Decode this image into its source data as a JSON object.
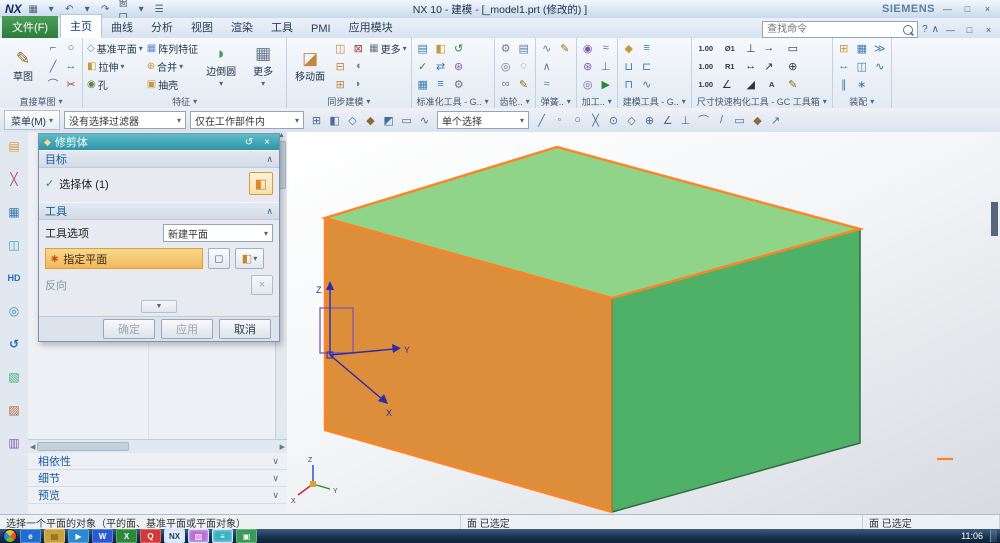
{
  "window": {
    "logo": "NX",
    "title": "NX 10 - 建模 - [_model1.prt (修改的) ]",
    "brand": "SIEMENS",
    "menu_window": "窗口"
  },
  "icons": {
    "save": "▦",
    "undo": "↶",
    "redo": "↷",
    "menu_list": "☰",
    "minimize": "—",
    "restore": "□",
    "close": "×",
    "help": "?",
    "ribbon_collapse": "∧",
    "chevron_up": "∧",
    "chevron_down": "∨",
    "dropdown": "▾",
    "check": "✓",
    "reset": "↺",
    "star": "∗",
    "expand_more": "▼",
    "cube": "◧",
    "plane": "◻",
    "plane_dialog": "◆",
    "reverse": "×",
    "scroll_up": "▲",
    "scroll_down": "▼",
    "scroll_left": "◀",
    "scroll_right": "▶"
  },
  "tabs": {
    "file_tab": "文件(F)",
    "items": [
      "主页",
      "曲线",
      "分析",
      "视图",
      "渲染",
      "工具",
      "PMI",
      "应用模块"
    ],
    "active_index": 0,
    "search_placeholder": "查找命令"
  },
  "ribbon": {
    "groups": [
      {
        "label": "直接草图",
        "name": "direct-sketch",
        "items": [
          {
            "n": "sketch-button",
            "t": "草图",
            "g": "✎",
            "c": "#8a6d1f",
            "big": true
          },
          {
            "n": "profile-icon",
            "g": "⌐",
            "c": "#3a6ea5"
          },
          {
            "n": "line-icon",
            "g": "╱",
            "c": "#3a6ea5"
          },
          {
            "n": "arc-icon",
            "g": "⌒",
            "c": "#3a6ea5"
          },
          {
            "n": "circle-icon",
            "g": "○",
            "c": "#3a6ea5"
          },
          {
            "n": "rapid-dimension-icon",
            "g": "↔",
            "c": "#3a6ea5"
          },
          {
            "n": "quick-trim-icon",
            "g": "✂",
            "c": "#a04040"
          }
        ]
      },
      {
        "label": "特征",
        "name": "feature",
        "items": [
          {
            "n": "datum-plane-button",
            "t": "基准平面",
            "g": "◇",
            "c": "#5b8fd4",
            "dd": true
          },
          {
            "n": "extrude-button",
            "t": "拉伸",
            "g": "◧",
            "c": "#c49a3a",
            "dd": true
          },
          {
            "n": "hole-button",
            "t": "孔",
            "g": "◉",
            "c": "#5a8a3a"
          },
          {
            "n": "pattern-feature-button",
            "t": "阵列特征",
            "g": "▦",
            "c": "#5b8fd4"
          },
          {
            "n": "unite-button",
            "t": "合并",
            "g": "⊕",
            "c": "#c49a3a",
            "dd": true
          },
          {
            "n": "shell-button",
            "t": "抽壳",
            "g": "▣",
            "c": "#c49a3a"
          },
          {
            "n": "edge-blend-button",
            "t": "边倒圆",
            "g": "◗",
            "c": "#4aa05a",
            "big": true,
            "dd": true
          },
          {
            "n": "more-feature-button",
            "t": "更多",
            "g": "▦",
            "c": "#667788",
            "big": true,
            "dd": true
          }
        ]
      },
      {
        "label": "同步建模",
        "name": "synchronous-modeling",
        "items": [
          {
            "n": "move-face-button",
            "t": "移动面",
            "g": "◪",
            "c": "#c08a3e",
            "big": true
          },
          {
            "n": "pull-face-icon",
            "g": "◫",
            "c": "#c08a3e"
          },
          {
            "n": "offset-region-icon",
            "g": "⊟",
            "c": "#c08a3e"
          },
          {
            "n": "replace-face-icon",
            "g": "⊞",
            "c": "#c08a3e"
          },
          {
            "n": "delete-face-icon",
            "g": "⊠",
            "c": "#a04040"
          },
          {
            "n": "make-coplanar-icon",
            "g": "◖",
            "c": "#4aa05a"
          },
          {
            "n": "resize-blend-icon",
            "g": "◗",
            "c": "#4aa05a"
          },
          {
            "n": "more-sync-button",
            "t": "更多",
            "g": "▦",
            "c": "#667788",
            "dd": true
          }
        ]
      },
      {
        "label": "标准化工具 - G..",
        "name": "standardization-tools",
        "items": [
          {
            "n": "gc-export-icon",
            "g": "▤",
            "c": "#3a7ab0"
          },
          {
            "n": "gc-check-icon",
            "g": "✓",
            "c": "#2a8a3a"
          },
          {
            "n": "gc-table-icon",
            "g": "▦",
            "c": "#3a7ab0"
          },
          {
            "n": "gc-part-icon",
            "g": "◧",
            "c": "#c49a3a"
          },
          {
            "n": "gc-replace-icon",
            "g": "⇄",
            "c": "#3a7ab0"
          },
          {
            "n": "gc-attribute-icon",
            "g": "≡",
            "c": "#3a7ab0"
          },
          {
            "n": "gc-cleanup-icon",
            "g": "↺",
            "c": "#2a8a3a"
          },
          {
            "n": "gc-tools-icon",
            "g": "⊛",
            "c": "#8a5ab0"
          },
          {
            "n": "gc-settings-icon",
            "g": "⚙",
            "c": "#667788"
          }
        ]
      },
      {
        "label": "齿轮..",
        "name": "gear",
        "items": [
          {
            "n": "cylinder-gear-icon",
            "g": "⚙",
            "c": "#5b7fa6"
          },
          {
            "n": "bevel-gear-icon",
            "g": "◎",
            "c": "#5b7fa6"
          },
          {
            "n": "gear-pair-icon",
            "g": "∞",
            "c": "#5b7fa6"
          },
          {
            "n": "rack-icon",
            "g": "▤",
            "c": "#5b7fa6"
          },
          {
            "n": "worm-gear-icon",
            "g": "◌",
            "c": "#5b7fa6"
          },
          {
            "n": "gear-edit-icon",
            "g": "✎",
            "c": "#8a6d1f"
          }
        ]
      },
      {
        "label": "弹簧..",
        "name": "spring",
        "items": [
          {
            "n": "cylinder-spring-icon",
            "g": "∿",
            "c": "#5b7fa6"
          },
          {
            "n": "conical-spring-icon",
            "g": "∧",
            "c": "#5b7fa6"
          },
          {
            "n": "leaf-spring-icon",
            "g": "≈",
            "c": "#5b7fa6"
          },
          {
            "n": "spring-edit-icon",
            "g": "✎",
            "c": "#8a6d1f"
          }
        ]
      },
      {
        "label": "加工..",
        "name": "machining",
        "items": [
          {
            "n": "drill-icon",
            "g": "◉",
            "c": "#7a5ab5"
          },
          {
            "n": "mill-icon",
            "g": "⊛",
            "c": "#7a5ab5"
          },
          {
            "n": "turn-icon",
            "g": "◎",
            "c": "#7a5ab5"
          },
          {
            "n": "wire-edm-icon",
            "g": "≈",
            "c": "#7a5ab5"
          },
          {
            "n": "tool-icon",
            "g": "⊥",
            "c": "#7a5ab5"
          },
          {
            "n": "simulate-icon",
            "g": "▶",
            "c": "#2a8a3a"
          }
        ]
      },
      {
        "label": "建模工具 - G..",
        "name": "modeling-tools",
        "items": [
          {
            "n": "bolt-icon",
            "g": "◆",
            "c": "#c49a3a"
          },
          {
            "n": "pocket-icon",
            "g": "⊔",
            "c": "#3a7ab0"
          },
          {
            "n": "boss-icon",
            "g": "⊓",
            "c": "#3a7ab0"
          },
          {
            "n": "rib-icon",
            "g": "≡",
            "c": "#3a7ab0"
          },
          {
            "n": "slot-icon",
            "g": "⊏",
            "c": "#3a7ab0"
          },
          {
            "n": "thread-icon",
            "g": "∿",
            "c": "#3a7ab0"
          }
        ]
      },
      {
        "label": "尺寸快速构化工具 - GC 工具箱",
        "name": "gc-dimension-toolbox",
        "items": [
          {
            "n": "dim-linear-icon",
            "g": "1.00",
            "c": "#333344",
            "txt": true
          },
          {
            "n": "dim-parallel-icon",
            "g": "1.00",
            "c": "#333344",
            "txt": true
          },
          {
            "n": "dim-vertical-icon",
            "g": "1.00",
            "c": "#333344",
            "txt": true
          },
          {
            "n": "dim-diameter-icon",
            "g": "Ø1",
            "c": "#333344",
            "txt": true
          },
          {
            "n": "dim-radius-icon",
            "g": "R1",
            "c": "#333344",
            "txt": true
          },
          {
            "n": "dim-angle-icon",
            "g": "∠",
            "c": "#333344"
          },
          {
            "n": "dim-perpendicular-icon",
            "g": "⊥",
            "c": "#333344"
          },
          {
            "n": "dim-symmetric-icon",
            "g": "↔",
            "c": "#333344"
          },
          {
            "n": "dim-chamfer-icon",
            "g": "◢",
            "c": "#333344"
          },
          {
            "n": "dim-arrow-icon",
            "g": "→",
            "c": "#333344"
          },
          {
            "n": "dim-leader-icon",
            "g": "↗",
            "c": "#333344"
          },
          {
            "n": "dim-text-icon",
            "g": "A",
            "c": "#333344",
            "txt": true
          },
          {
            "n": "dim-frame-icon",
            "g": "▭",
            "c": "#333344"
          },
          {
            "n": "dim-datum-icon",
            "g": "⊕",
            "c": "#333344"
          },
          {
            "n": "dim-edit-icon",
            "g": "✎",
            "c": "#8a6d1f"
          }
        ]
      },
      {
        "label": "装配",
        "name": "assembly",
        "items": [
          {
            "n": "add-component-icon",
            "g": "⊞",
            "c": "#c49a3a"
          },
          {
            "n": "move-component-icon",
            "g": "↔",
            "c": "#3a7ab0"
          },
          {
            "n": "assembly-constraints-icon",
            "g": "∥",
            "c": "#3a7ab0"
          },
          {
            "n": "pattern-component-icon",
            "g": "▦",
            "c": "#3a7ab0"
          },
          {
            "n": "mirror-assembly-icon",
            "g": "◫",
            "c": "#3a7ab0"
          },
          {
            "n": "exploded-view-icon",
            "g": "∗",
            "c": "#3a7ab0"
          },
          {
            "n": "sequence-icon",
            "g": "≫",
            "c": "#3a7ab0"
          },
          {
            "n": "wave-link-icon",
            "g": "∿",
            "c": "#3a7ab0"
          }
        ]
      }
    ]
  },
  "selbar": {
    "menu": "菜单(M)",
    "filter": "没有选择过滤器",
    "scope": "仅在工作部件内",
    "mode": "单个选择",
    "pre_icons": [
      {
        "n": "touch-mode-icon",
        "g": "⊞",
        "c": "#4a6a9a"
      },
      {
        "n": "select-filter-face-icon",
        "g": "◧",
        "c": "#4a6a9a"
      },
      {
        "n": "select-filter-edge-icon",
        "g": "◇",
        "c": "#4a6a9a"
      },
      {
        "n": "select-filter-body-icon",
        "g": "◆",
        "c": "#8a6a3a"
      },
      {
        "n": "highlight-selection-icon",
        "g": "◩",
        "c": "#4a6a9a"
      },
      {
        "n": "selection-rectangle-icon",
        "g": "▭",
        "c": "#4a6a9a"
      },
      {
        "n": "lasso-icon",
        "g": "∿",
        "c": "#4a6a9a"
      }
    ],
    "post_icons": [
      {
        "n": "snap-endpoint-icon",
        "g": "╱",
        "c": "#4a6a9a"
      },
      {
        "n": "snap-midpoint-icon",
        "g": "◦",
        "c": "#4a6a9a"
      },
      {
        "n": "snap-center-icon",
        "g": "○",
        "c": "#4a6a9a"
      },
      {
        "n": "snap-intersection-icon",
        "g": "╳",
        "c": "#4a6a9a"
      },
      {
        "n": "snap-quadrant-icon",
        "g": "⊙",
        "c": "#4a6a9a"
      },
      {
        "n": "snap-point-on-curve-icon",
        "g": "◇",
        "c": "#4a6a9a"
      },
      {
        "n": "snap-existing-point-icon",
        "g": "⊕",
        "c": "#4a6a9a"
      },
      {
        "n": "snap-angle-icon",
        "g": "∠",
        "c": "#4a6a9a"
      },
      {
        "n": "snap-perpendicular-icon",
        "g": "⊥",
        "c": "#4a6a9a"
      },
      {
        "n": "snap-tangent-icon",
        "g": "⌒",
        "c": "#4a6a9a"
      },
      {
        "n": "snap-line-icon",
        "g": "/",
        "c": "#4a6a9a"
      },
      {
        "n": "snap-face-icon",
        "g": "▭",
        "c": "#4a6a9a"
      },
      {
        "n": "snap-body-icon",
        "g": "◆",
        "c": "#8a6a3a"
      },
      {
        "n": "snap-vector-icon",
        "g": "↗",
        "c": "#4a6a9a"
      }
    ]
  },
  "sidebar": {
    "items": [
      {
        "n": "assembly-navigator-icon",
        "g": "▤",
        "c": "#d89a3a"
      },
      {
        "n": "constraint-navigator-icon",
        "g": "╳",
        "c": "#b04a6a"
      },
      {
        "n": "part-navigator-icon",
        "g": "▦",
        "c": "#3a7ab0"
      },
      {
        "n": "reuse-library-icon",
        "g": "◫",
        "c": "#2a9ab0"
      },
      {
        "n": "hd3d-tools-icon",
        "g": "HD",
        "c": "#2a6ac0",
        "small": true
      },
      {
        "n": "web-browser-icon",
        "g": "◎",
        "c": "#2a8ac0"
      },
      {
        "n": "history-icon",
        "g": "↺",
        "c": "#2a6ac0"
      },
      {
        "n": "process-studio-icon",
        "g": "▧",
        "c": "#3ab06a"
      },
      {
        "n": "materials-icon",
        "g": "▨",
        "c": "#b06a3a"
      },
      {
        "n": "palette-icon",
        "g": "▥",
        "c": "#8a5ab0"
      }
    ]
  },
  "dialog": {
    "title": "修剪体",
    "target": {
      "header": "目标",
      "select_body": "选择体 (1)"
    },
    "tool": {
      "header": "工具",
      "option_label": "工具选项",
      "option_value": "新建平面",
      "specify_plane": "指定平面",
      "reverse": "反向"
    },
    "buttons": {
      "ok": "确定",
      "apply": "应用",
      "cancel": "取消"
    }
  },
  "panel": {
    "sections": [
      "相依性",
      "细节",
      "预览"
    ]
  },
  "status": {
    "prompt": "选择一个平面的对象（平的面、基准平面或平面对象）",
    "selection_mid": "面 已选定",
    "selection_right": "面 已选定"
  },
  "taskbar": {
    "time": "11:06",
    "icons": [
      {
        "n": "browser-icon",
        "g": "e",
        "c": "#ffffff",
        "bg": "#1e6fd0"
      },
      {
        "n": "explorer-icon",
        "g": "▤",
        "c": "#6a4a10",
        "bg": "#caa23a"
      },
      {
        "n": "media-player-icon",
        "g": "▶",
        "c": "#ffffff",
        "bg": "#2a8ad0"
      },
      {
        "n": "word-icon",
        "g": "W",
        "c": "#ffffff",
        "bg": "#2a5ad0"
      },
      {
        "n": "excel-icon",
        "g": "X",
        "c": "#ffffff",
        "bg": "#2a8a3a"
      },
      {
        "n": "messenger-icon",
        "g": "Q",
        "c": "#ffffff",
        "bg": "#d03a3a"
      },
      {
        "n": "nx-taskbar-icon",
        "g": "NX",
        "c": "#1a3a6a",
        "bg": "#e8eef6",
        "active": true
      },
      {
        "n": "paint-icon",
        "g": "▨",
        "c": "#ffffff",
        "bg": "#c06ad0",
        "active": true
      },
      {
        "n": "notepad-icon",
        "g": "≡",
        "c": "#ffffff",
        "bg": "#3ab0c0",
        "active": true
      },
      {
        "n": "image-viewer-icon",
        "g": "▣",
        "c": "#ffffff",
        "bg": "#3a9a5a"
      }
    ]
  },
  "scene": {
    "top_color": "#90d48a",
    "front_color": "#dd8e3b",
    "side_color": "#4eb167",
    "edge_highlight": "#ff8326",
    "edge_dark": "#2f6b44",
    "axis_color": "#2b2bb0",
    "sketch_color": "#7a5ab5",
    "triad_x_color": "#cc2222",
    "triad_y_color": "#2a8a2a",
    "triad_z_color": "#2244cc",
    "axis_x": "X",
    "axis_y": "Y",
    "axis_z": "Z"
  }
}
